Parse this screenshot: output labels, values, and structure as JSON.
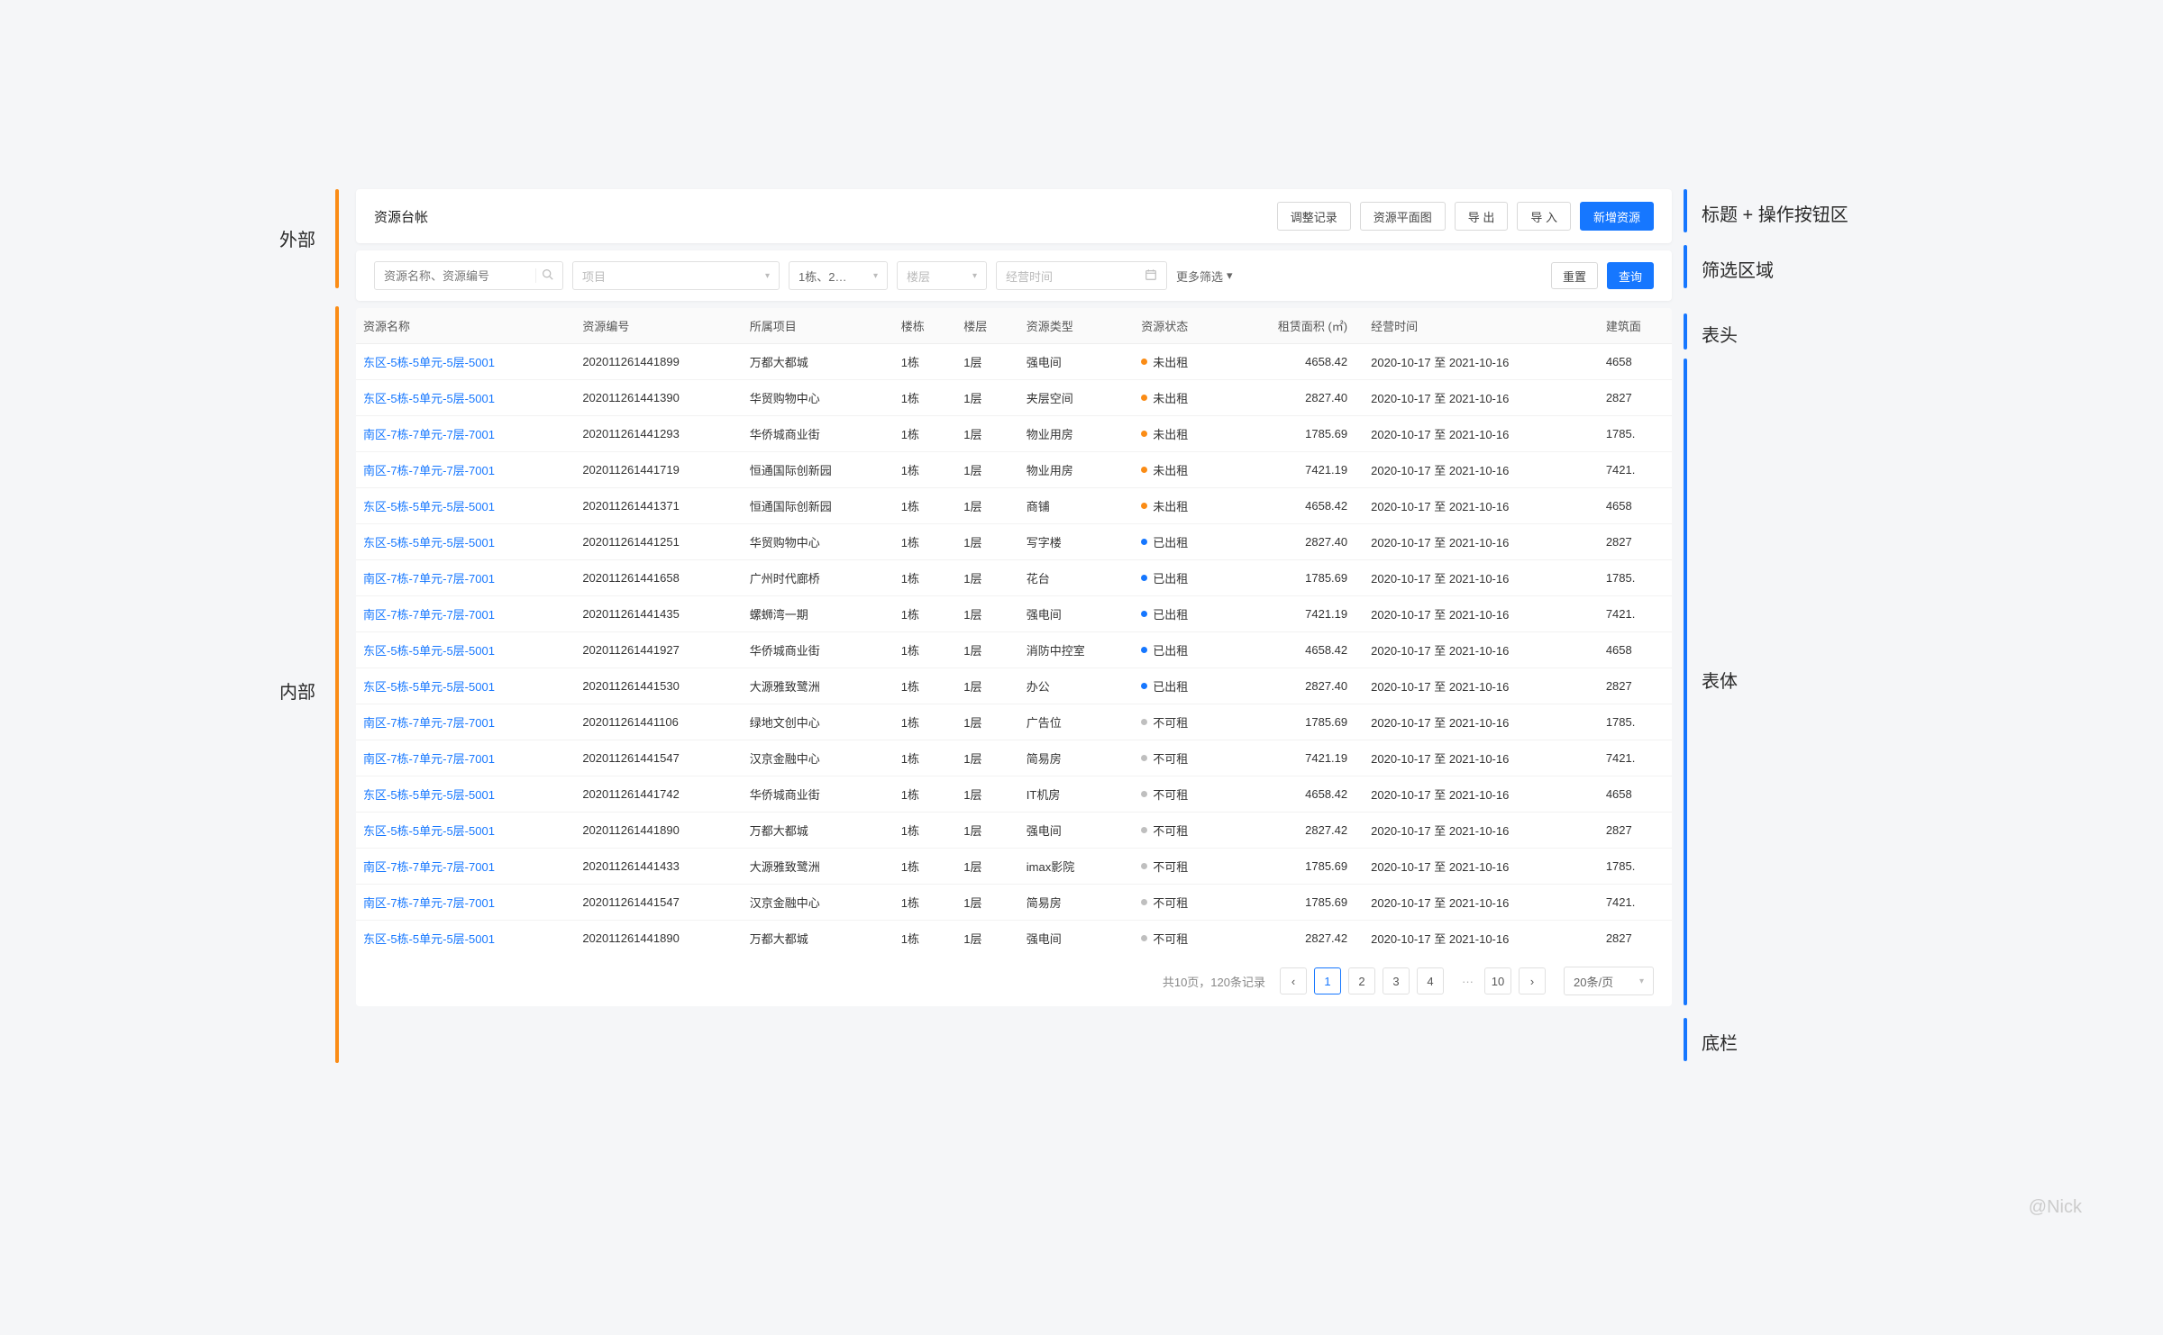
{
  "watermark": "@Nick",
  "annotations": {
    "outer": "外部",
    "inner": "内部",
    "title_buttons": "标题 + 操作按钮区",
    "filter_area": "筛选区域",
    "thead": "表头",
    "tbody": "表体",
    "footer": "底栏"
  },
  "header": {
    "title": "资源台帐",
    "buttons": {
      "adjust_log": "调整记录",
      "floor_plan": "资源平面图",
      "export": "导 出",
      "import": "导 入",
      "add": "新增资源"
    }
  },
  "filters": {
    "search_placeholder": "资源名称、资源编号",
    "project_placeholder": "项目",
    "building_value": "1栋、2…",
    "floor_placeholder": "楼层",
    "time_placeholder": "经营时间",
    "more": "更多筛选",
    "reset": "重置",
    "query": "查询"
  },
  "columns": [
    "资源名称",
    "资源编号",
    "所属项目",
    "楼栋",
    "楼层",
    "资源类型",
    "资源状态",
    "租赁面积 (㎡)",
    "经营时间",
    "建筑面"
  ],
  "status_labels": {
    "unrented": "未出租",
    "rented": "已出租",
    "unavailable": "不可租"
  },
  "rows": [
    {
      "name": "东区-5栋-5单元-5层-5001",
      "code": "202011261441899",
      "project": "万都大都城",
      "building": "1栋",
      "floor": "1层",
      "type": "强电间",
      "status": "unrented",
      "area": "4658.42",
      "period": "2020-10-17 至 2021-10-16",
      "extra": "4658"
    },
    {
      "name": "东区-5栋-5单元-5层-5001",
      "code": "202011261441390",
      "project": "华贸购物中心",
      "building": "1栋",
      "floor": "1层",
      "type": "夹层空间",
      "status": "unrented",
      "area": "2827.40",
      "period": "2020-10-17 至 2021-10-16",
      "extra": "2827"
    },
    {
      "name": "南区-7栋-7单元-7层-7001",
      "code": "202011261441293",
      "project": "华侨城商业街",
      "building": "1栋",
      "floor": "1层",
      "type": "物业用房",
      "status": "unrented",
      "area": "1785.69",
      "period": "2020-10-17 至 2021-10-16",
      "extra": "1785."
    },
    {
      "name": "南区-7栋-7单元-7层-7001",
      "code": "202011261441719",
      "project": "恒通国际创新园",
      "building": "1栋",
      "floor": "1层",
      "type": "物业用房",
      "status": "unrented",
      "area": "7421.19",
      "period": "2020-10-17 至 2021-10-16",
      "extra": "7421."
    },
    {
      "name": "东区-5栋-5单元-5层-5001",
      "code": "202011261441371",
      "project": "恒通国际创新园",
      "building": "1栋",
      "floor": "1层",
      "type": "商铺",
      "status": "unrented",
      "area": "4658.42",
      "period": "2020-10-17 至 2021-10-16",
      "extra": "4658"
    },
    {
      "name": "东区-5栋-5单元-5层-5001",
      "code": "202011261441251",
      "project": "华贸购物中心",
      "building": "1栋",
      "floor": "1层",
      "type": "写字楼",
      "status": "rented",
      "area": "2827.40",
      "period": "2020-10-17 至 2021-10-16",
      "extra": "2827"
    },
    {
      "name": "南区-7栋-7单元-7层-7001",
      "code": "202011261441658",
      "project": "广州时代廊桥",
      "building": "1栋",
      "floor": "1层",
      "type": "花台",
      "status": "rented",
      "area": "1785.69",
      "period": "2020-10-17 至 2021-10-16",
      "extra": "1785."
    },
    {
      "name": "南区-7栋-7单元-7层-7001",
      "code": "202011261441435",
      "project": "螺蛳湾一期",
      "building": "1栋",
      "floor": "1层",
      "type": "强电间",
      "status": "rented",
      "area": "7421.19",
      "period": "2020-10-17 至 2021-10-16",
      "extra": "7421."
    },
    {
      "name": "东区-5栋-5单元-5层-5001",
      "code": "202011261441927",
      "project": "华侨城商业街",
      "building": "1栋",
      "floor": "1层",
      "type": "消防中控室",
      "status": "rented",
      "area": "4658.42",
      "period": "2020-10-17 至 2021-10-16",
      "extra": "4658"
    },
    {
      "name": "东区-5栋-5单元-5层-5001",
      "code": "202011261441530",
      "project": "大源雅致鹭洲",
      "building": "1栋",
      "floor": "1层",
      "type": "办公",
      "status": "rented",
      "area": "2827.40",
      "period": "2020-10-17 至 2021-10-16",
      "extra": "2827"
    },
    {
      "name": "南区-7栋-7单元-7层-7001",
      "code": "202011261441106",
      "project": "绿地文创中心",
      "building": "1栋",
      "floor": "1层",
      "type": "广告位",
      "status": "unavailable",
      "area": "1785.69",
      "period": "2020-10-17 至 2021-10-16",
      "extra": "1785."
    },
    {
      "name": "南区-7栋-7单元-7层-7001",
      "code": "202011261441547",
      "project": "汉京金融中心",
      "building": "1栋",
      "floor": "1层",
      "type": "简易房",
      "status": "unavailable",
      "area": "7421.19",
      "period": "2020-10-17 至 2021-10-16",
      "extra": "7421."
    },
    {
      "name": "东区-5栋-5单元-5层-5001",
      "code": "202011261441742",
      "project": "华侨城商业街",
      "building": "1栋",
      "floor": "1层",
      "type": "IT机房",
      "status": "unavailable",
      "area": "4658.42",
      "period": "2020-10-17 至 2021-10-16",
      "extra": "4658"
    },
    {
      "name": "东区-5栋-5单元-5层-5001",
      "code": "202011261441890",
      "project": "万都大都城",
      "building": "1栋",
      "floor": "1层",
      "type": "强电间",
      "status": "unavailable",
      "area": "2827.42",
      "period": "2020-10-17 至 2021-10-16",
      "extra": "2827"
    },
    {
      "name": "南区-7栋-7单元-7层-7001",
      "code": "202011261441433",
      "project": "大源雅致鹭洲",
      "building": "1栋",
      "floor": "1层",
      "type": "imax影院",
      "status": "unavailable",
      "area": "1785.69",
      "period": "2020-10-17 至 2021-10-16",
      "extra": "1785."
    },
    {
      "name": "南区-7栋-7单元-7层-7001",
      "code": "202011261441547",
      "project": "汉京金融中心",
      "building": "1栋",
      "floor": "1层",
      "type": "简易房",
      "status": "unavailable",
      "area": "1785.69",
      "period": "2020-10-17 至 2021-10-16",
      "extra": "7421."
    },
    {
      "name": "东区-5栋-5单元-5层-5001",
      "code": "202011261441890",
      "project": "万都大都城",
      "building": "1栋",
      "floor": "1层",
      "type": "强电间",
      "status": "unavailable",
      "area": "2827.42",
      "period": "2020-10-17 至 2021-10-16",
      "extra": "2827"
    }
  ],
  "pager": {
    "summary": "共10页，120条记录",
    "pages": [
      "1",
      "2",
      "3",
      "4"
    ],
    "last_page": "10",
    "active": "1",
    "size": "20条/页",
    "prev": "‹",
    "next": "›",
    "ellipsis": "···"
  }
}
